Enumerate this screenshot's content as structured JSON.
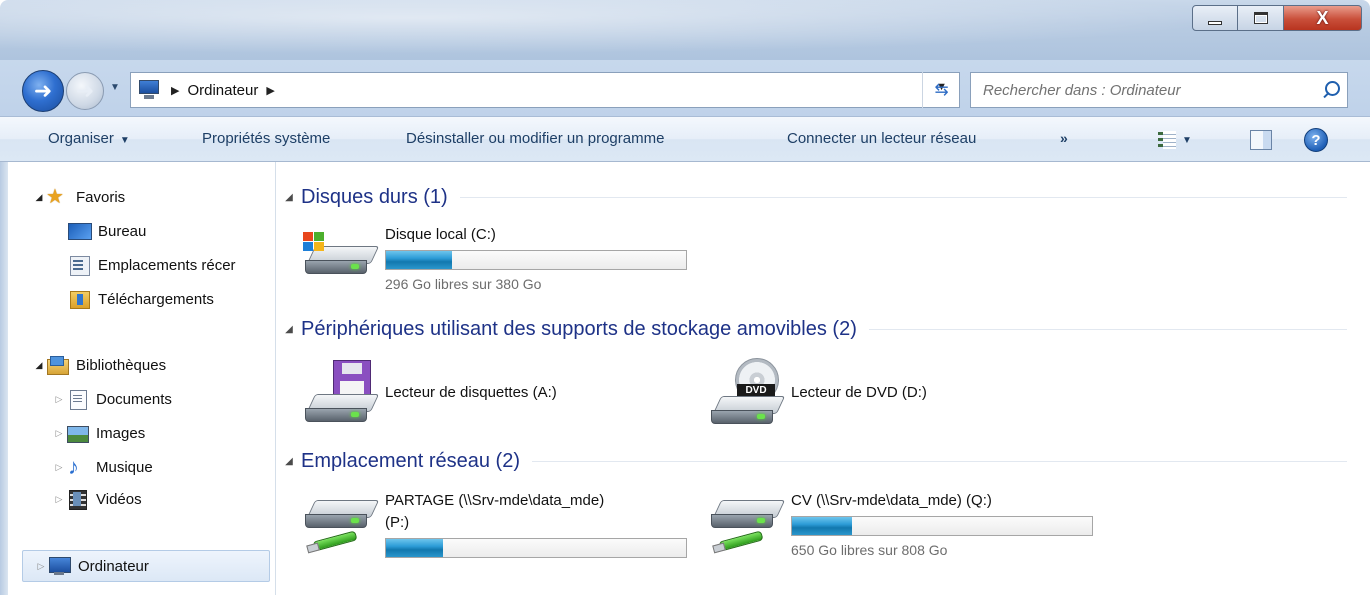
{
  "window": {
    "min_label": "",
    "max_label": "",
    "close_label": "X"
  },
  "address": {
    "crumb": "Ordinateur",
    "search_placeholder": "Rechercher dans : Ordinateur"
  },
  "toolbar": {
    "organiser": "Organiser",
    "proprietes": "Propriétés système",
    "desinstaller": "Désinstaller ou modifier un programme",
    "connecter": "Connecter un lecteur réseau",
    "more": "»",
    "help": "?"
  },
  "nav": {
    "favoris": "Favoris",
    "bureau": "Bureau",
    "emplacements": "Emplacements récer",
    "telechargements": "Téléchargements",
    "bibliotheques": "Bibliothèques",
    "documents": "Documents",
    "images": "Images",
    "musique": "Musique",
    "videos": "Vidéos",
    "ordinateur": "Ordinateur"
  },
  "groups": {
    "hdd": {
      "title": "Disques durs (1)"
    },
    "removable": {
      "title": "Périphériques utilisant des supports de stockage amovibles (2)"
    },
    "network": {
      "title": "Emplacement réseau (2)"
    }
  },
  "drives": {
    "c": {
      "name": "Disque local (C:)",
      "free_text": "296 Go libres sur 380 Go",
      "used_fraction": 0.22
    },
    "a": {
      "name": "Lecteur de disquettes (A:)"
    },
    "d": {
      "name": "Lecteur de DVD (D:)",
      "badge": "DVD"
    },
    "p": {
      "name_line1": "PARTAGE (\\\\Srv-mde\\data_mde)",
      "name_line2": "(P:)",
      "used_fraction": 0.19
    },
    "q": {
      "name": "CV (\\\\Srv-mde\\data_mde) (Q:)",
      "free_text": "650 Go libres sur 808 Go",
      "used_fraction": 0.2
    }
  },
  "colors": {
    "group_title": "#1e3287",
    "command_text": "#1e3f66",
    "close_button": "#c94f3a"
  }
}
